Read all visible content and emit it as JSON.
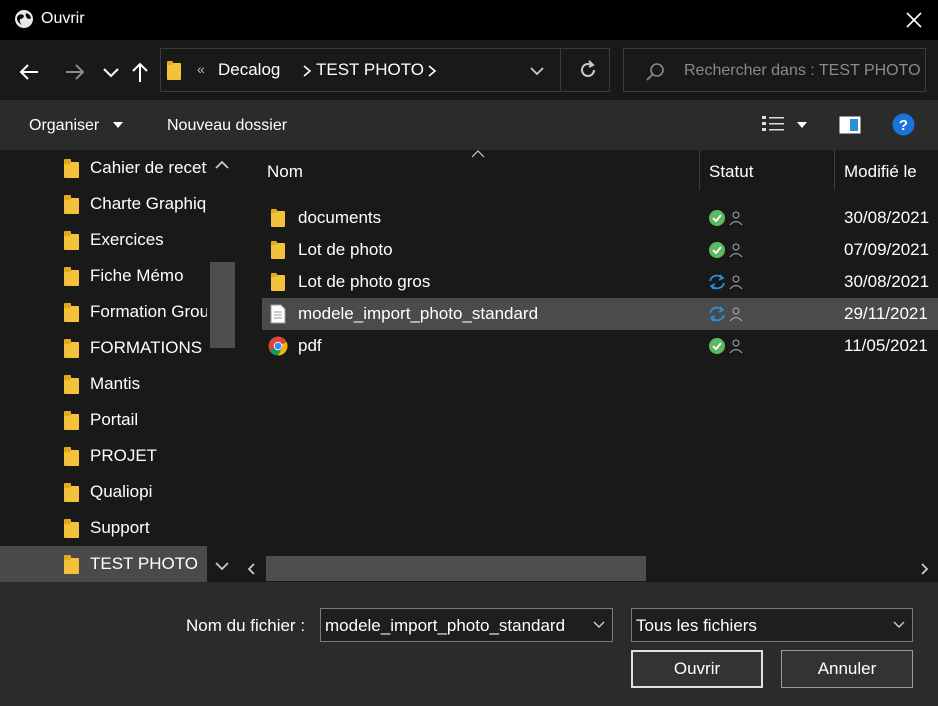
{
  "window": {
    "title": "Ouvrir",
    "app_icon": "globe-icon"
  },
  "nav": {
    "back_icon": "arrow-left-icon",
    "forward_icon": "arrow-right-icon",
    "recent_icon": "chevron-down-icon",
    "up_icon": "arrow-up-icon",
    "breadcrumb_prefix": "«",
    "breadcrumb": [
      "Decalog",
      "TEST PHOTO"
    ],
    "refresh_icon": "refresh-icon"
  },
  "search": {
    "placeholder": "Rechercher dans : TEST PHOTO"
  },
  "toolbar": {
    "organize_label": "Organiser",
    "new_folder_label": "Nouveau dossier",
    "help_label": "?"
  },
  "sidebar": {
    "items": [
      {
        "label": "Cahier de recette"
      },
      {
        "label": "Charte Graphique"
      },
      {
        "label": "Exercices"
      },
      {
        "label": "Fiche Mémo"
      },
      {
        "label": "Formation Groupe"
      },
      {
        "label": "FORMATIONS"
      },
      {
        "label": "Mantis"
      },
      {
        "label": "Portail"
      },
      {
        "label": "PROJET"
      },
      {
        "label": "Qualiopi"
      },
      {
        "label": "Support"
      },
      {
        "label": "TEST PHOTO",
        "selected": true
      }
    ]
  },
  "files": {
    "columns": {
      "name": "Nom",
      "status": "Statut",
      "modified": "Modifié le"
    },
    "rows": [
      {
        "name": "documents",
        "type": "folder",
        "status": "synced",
        "date": "30/08/2021"
      },
      {
        "name": "Lot de photo",
        "type": "folder",
        "status": "synced",
        "date": "07/09/2021"
      },
      {
        "name": "Lot de photo gros",
        "type": "folder",
        "status": "syncing",
        "date": "30/08/2021"
      },
      {
        "name": "modele_import_photo_standard",
        "type": "document",
        "status": "syncing",
        "date": "29/11/2021",
        "selected": true
      },
      {
        "name": "pdf",
        "type": "chrome",
        "status": "synced",
        "date": "11/05/2021"
      }
    ]
  },
  "bottom": {
    "filename_label": "Nom du fichier :",
    "filename_value": "modele_import_photo_standard",
    "filter_value": "Tous les fichiers",
    "open_label": "Ouvrir",
    "cancel_label": "Annuler"
  },
  "colors": {
    "background": "#191919",
    "toolbar": "#2b2b2b",
    "selected": "#4b4b4b",
    "folder": "#f4c23a",
    "sync_green": "#5fb85f",
    "sync_blue": "#2d8fd8",
    "help_blue": "#1a73d9"
  }
}
